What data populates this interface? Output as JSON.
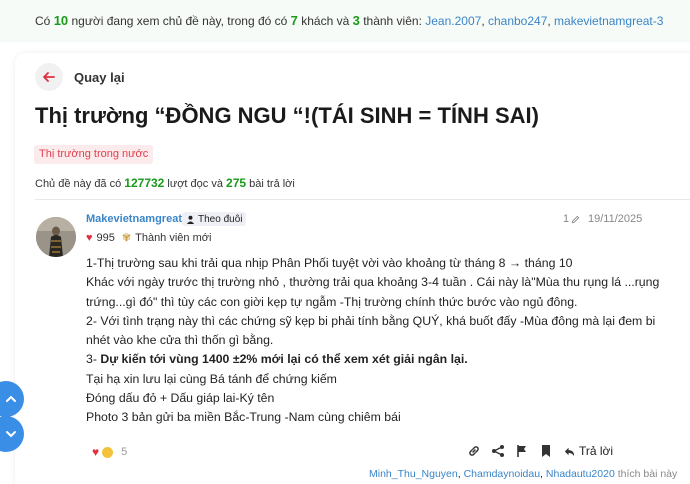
{
  "viewers": {
    "prefix": "Có",
    "total": "10",
    "mid1": "người đang xem chủ đề này, trong đó có",
    "guests": "7",
    "mid2": "khách và",
    "members_count": "3",
    "mid3": "thành viên:",
    "members": [
      "Jean.2007",
      "chanbo247",
      "makevietnamgreat-3"
    ]
  },
  "nav": {
    "back_label": "Quay lại"
  },
  "thread": {
    "title": "Thị trường “ĐỒNG NGU “!(TÁI SINH = TÍNH SAI)",
    "category": "Thị trường trong nước",
    "stats_prefix": "Chủ đề này đã có",
    "views": "127732",
    "stats_mid": "lượt đọc và",
    "replies": "275",
    "stats_suffix": "bài trả lời"
  },
  "post": {
    "author": "Makevietnamgreat",
    "follow_label": "Theo đuôi",
    "reactions_received": "995",
    "rank": "Thành viên mới",
    "edit_count": "1",
    "date": "19/11/2025",
    "lines": [
      "1-Thị trường sau khi trải qua nhịp Phân Phối tuyệt vời vào khoảng từ tháng 8 → tháng 10",
      "Khác với ngày trước thị trường nhỏ , thường trải qua khoảng 3-4 tuần . Cái này là\"Mùa thu rụng lá ...rụng",
      "trứng...gì đó\" thì tùy các con giời kẹp tự ngẫm -Thị trường chính thức bước vào ngủ đông.",
      "2- Với tình trạng này thì các chứng sỹ kẹp bi phải tính bằng QUÝ, khá buốt đấy -Mùa đông mà lại đem bi",
      "nhét vào khe cửa thì thốn gì bằng."
    ],
    "bold_prefix": "3- ",
    "bold_line": "Dự kiến tới vùng 1400 ±2% mới lại có thể xem xét giải ngân lại.",
    "lines_after": [
      "Tại hạ xin lưu lại cùng Bá tánh để chứng kiếm",
      "Đóng dấu đỏ + Dấu giáp lai-Ký tên",
      "Photo 3 bản gửi ba miền Bắc-Trung -Nam cùng chiêm bái"
    ],
    "reaction_count": "5",
    "reply_label": "Trả lời",
    "likers": [
      "Minh_Thu_Nguyen",
      "Chamdaynoidau",
      "Nhadautu2020"
    ],
    "likers_suffix": "thích bài này"
  },
  "colors": {
    "accent_green": "#1a9a1a",
    "link_blue": "#3a85c9",
    "scroll_blue": "#3a8ee6",
    "category_red": "#e04050"
  }
}
